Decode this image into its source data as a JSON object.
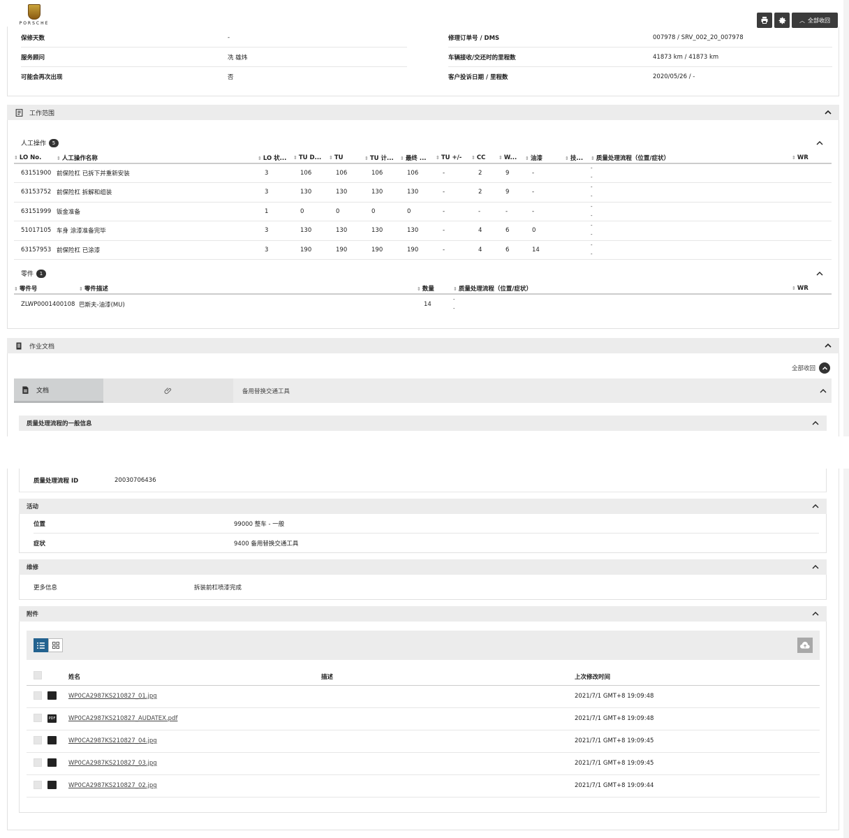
{
  "header": {
    "logo_text": "PORSCHE",
    "collapse_all": "全部收回"
  },
  "info": {
    "left": [
      {
        "label": "保修天数",
        "value": "-"
      },
      {
        "label": "服务顾问",
        "value": "冼 雄炜"
      },
      {
        "label": "可能会再次出现",
        "value": "否"
      }
    ],
    "right": [
      {
        "label": "修理订单号 / DMS",
        "value": "007978 / SRV_002_20_007978"
      },
      {
        "label": "车辆接收/交还时的里程数",
        "value": "41873 km / 41873 km"
      },
      {
        "label": "客户投诉日期 / 里程数",
        "value": "2020/05/26 / -"
      }
    ]
  },
  "work_scope": {
    "title": "工作范围",
    "labor": {
      "title": "人工操作",
      "count": "5",
      "columns": [
        "LO No.",
        "人工操作名称",
        "LO 状...",
        "TU D...",
        "TU",
        "TU 计...",
        "最终 ...",
        "TU +/-",
        "CC",
        "W...",
        "油漆",
        "技...",
        "质量处理流程（位置/症状）",
        "WR"
      ],
      "rows": [
        [
          "63151900",
          "前保险杠 已拆下并重新安装",
          "3",
          "106",
          "106",
          "106",
          "106",
          "-",
          "2",
          "9",
          "-",
          "",
          "-",
          ""
        ],
        [
          "63153752",
          "前保险杠 拆解和组装",
          "3",
          "130",
          "130",
          "130",
          "130",
          "-",
          "2",
          "9",
          "-",
          "",
          "-",
          ""
        ],
        [
          "63151999",
          "钣金准备",
          "1",
          "0",
          "0",
          "0",
          "0",
          "-",
          "-",
          "-",
          "-",
          "",
          "-",
          ""
        ],
        [
          "51017105",
          "车身 涂漆准备完毕",
          "3",
          "130",
          "130",
          "130",
          "130",
          "-",
          "4",
          "6",
          "0",
          "",
          "-",
          ""
        ],
        [
          "63157953",
          "前保险杠 已涂漆",
          "3",
          "190",
          "190",
          "190",
          "190",
          "-",
          "4",
          "6",
          "14",
          "",
          "-",
          ""
        ]
      ]
    },
    "parts": {
      "title": "零件",
      "count": "1",
      "columns": [
        "零件号",
        "零件描述",
        "数量",
        "质量处理流程（位置/症状）",
        "WR"
      ],
      "rows": [
        [
          "ZLWP0001400108",
          "巴斯夫-油漆(MU)",
          "14",
          "-",
          ""
        ]
      ]
    }
  },
  "work_docs": {
    "title": "作业文档",
    "collapse_all": "全部收回",
    "tab_docs": "文档",
    "panel_title": "备用替换交通工具",
    "general_info": "质量处理流程的一般信息",
    "qp_id_label": "质量处理流程 ID",
    "qp_id_value": "20030706436",
    "activity": {
      "title": "活动",
      "location_label": "位置",
      "location_value": "99000 整车 - 一般",
      "symptom_label": "症状",
      "symptom_value": "9400 备用替换交通工具"
    },
    "repair": {
      "title": "维修",
      "more_label": "更多信息",
      "more_value": "拆装前杠喷漆完成"
    },
    "attachments": {
      "title": "附件",
      "columns": [
        "姓名",
        "描述",
        "上次修改时间"
      ],
      "rows": [
        {
          "type": "image",
          "name": "WP0CA2987KS210827_01.jpg",
          "desc": "",
          "time": "2021/7/1 GMT+8 19:09:48"
        },
        {
          "type": "pdf",
          "name": "WP0CA2987KS210827_AUDATEX.pdf",
          "desc": "",
          "time": "2021/7/1 GMT+8 19:09:48"
        },
        {
          "type": "image",
          "name": "WP0CA2987KS210827_04.jpg",
          "desc": "",
          "time": "2021/7/1 GMT+8 19:09:45"
        },
        {
          "type": "image",
          "name": "WP0CA2987KS210827_03.jpg",
          "desc": "",
          "time": "2021/7/1 GMT+8 19:09:45"
        },
        {
          "type": "image",
          "name": "WP0CA2987KS210827_02.jpg",
          "desc": "",
          "time": "2021/7/1 GMT+8 19:09:44"
        }
      ]
    }
  }
}
